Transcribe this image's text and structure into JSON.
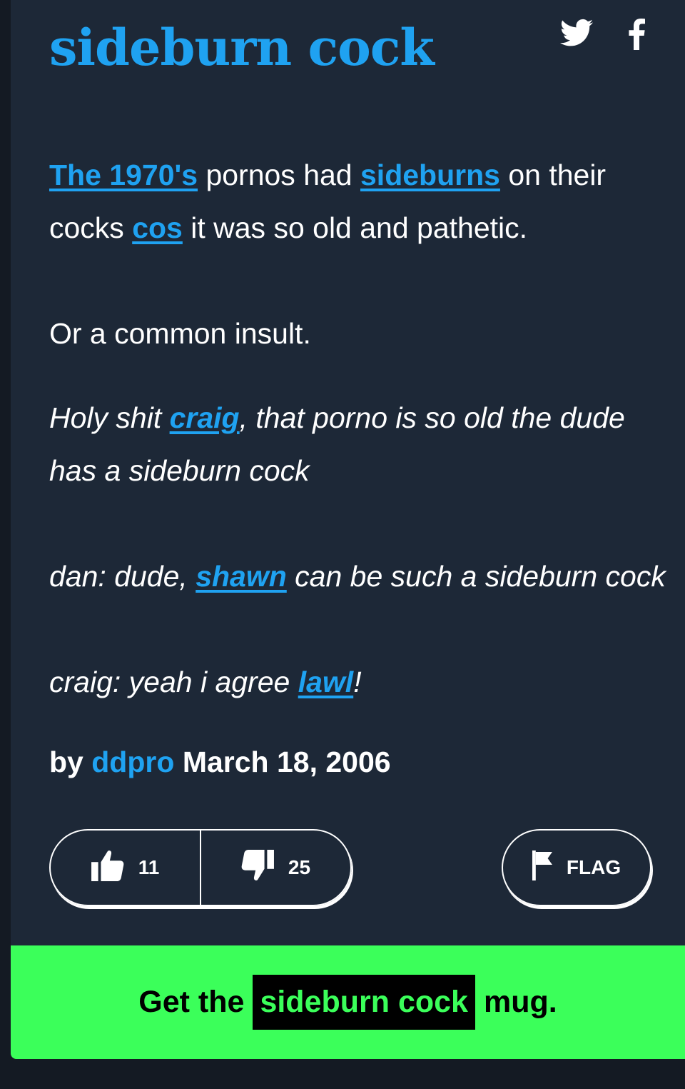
{
  "entry": {
    "word": "sideburn cock",
    "definition": {
      "line1_link1": "The 1970's",
      "line1_text1": " pornos had ",
      "line1_link2": "sideburns",
      "line1_text2": " on their cocks ",
      "line1_link3": "cos",
      "line1_text3": " it was so old and pathetic.",
      "line2": "Or a common insult."
    },
    "example1": {
      "text1": "Holy shit ",
      "link": "craig",
      "text2": ", that porno is so old the dude has a sideburn cock"
    },
    "example2": {
      "text1": "dan: dude, ",
      "link": "shawn",
      "text2": " can be such a sideburn cock"
    },
    "example3": {
      "text1": "craig: yeah i agree ",
      "link": "lawl",
      "text2": "!"
    },
    "byline": {
      "by": "by",
      "author": "ddpro",
      "date": "March 18, 2006"
    },
    "votes": {
      "up_count": "11",
      "down_count": "25"
    },
    "flag_label": "FLAG"
  },
  "share": {
    "twitter_icon": "twitter-icon",
    "facebook_icon": "facebook-icon"
  },
  "mug": {
    "prefix": "Get the",
    "word": "sideburn cock",
    "suffix": "mug."
  },
  "colors": {
    "accent": "#1fa2f1",
    "card": "#1d2837",
    "mug_green": "#3bff5a"
  }
}
